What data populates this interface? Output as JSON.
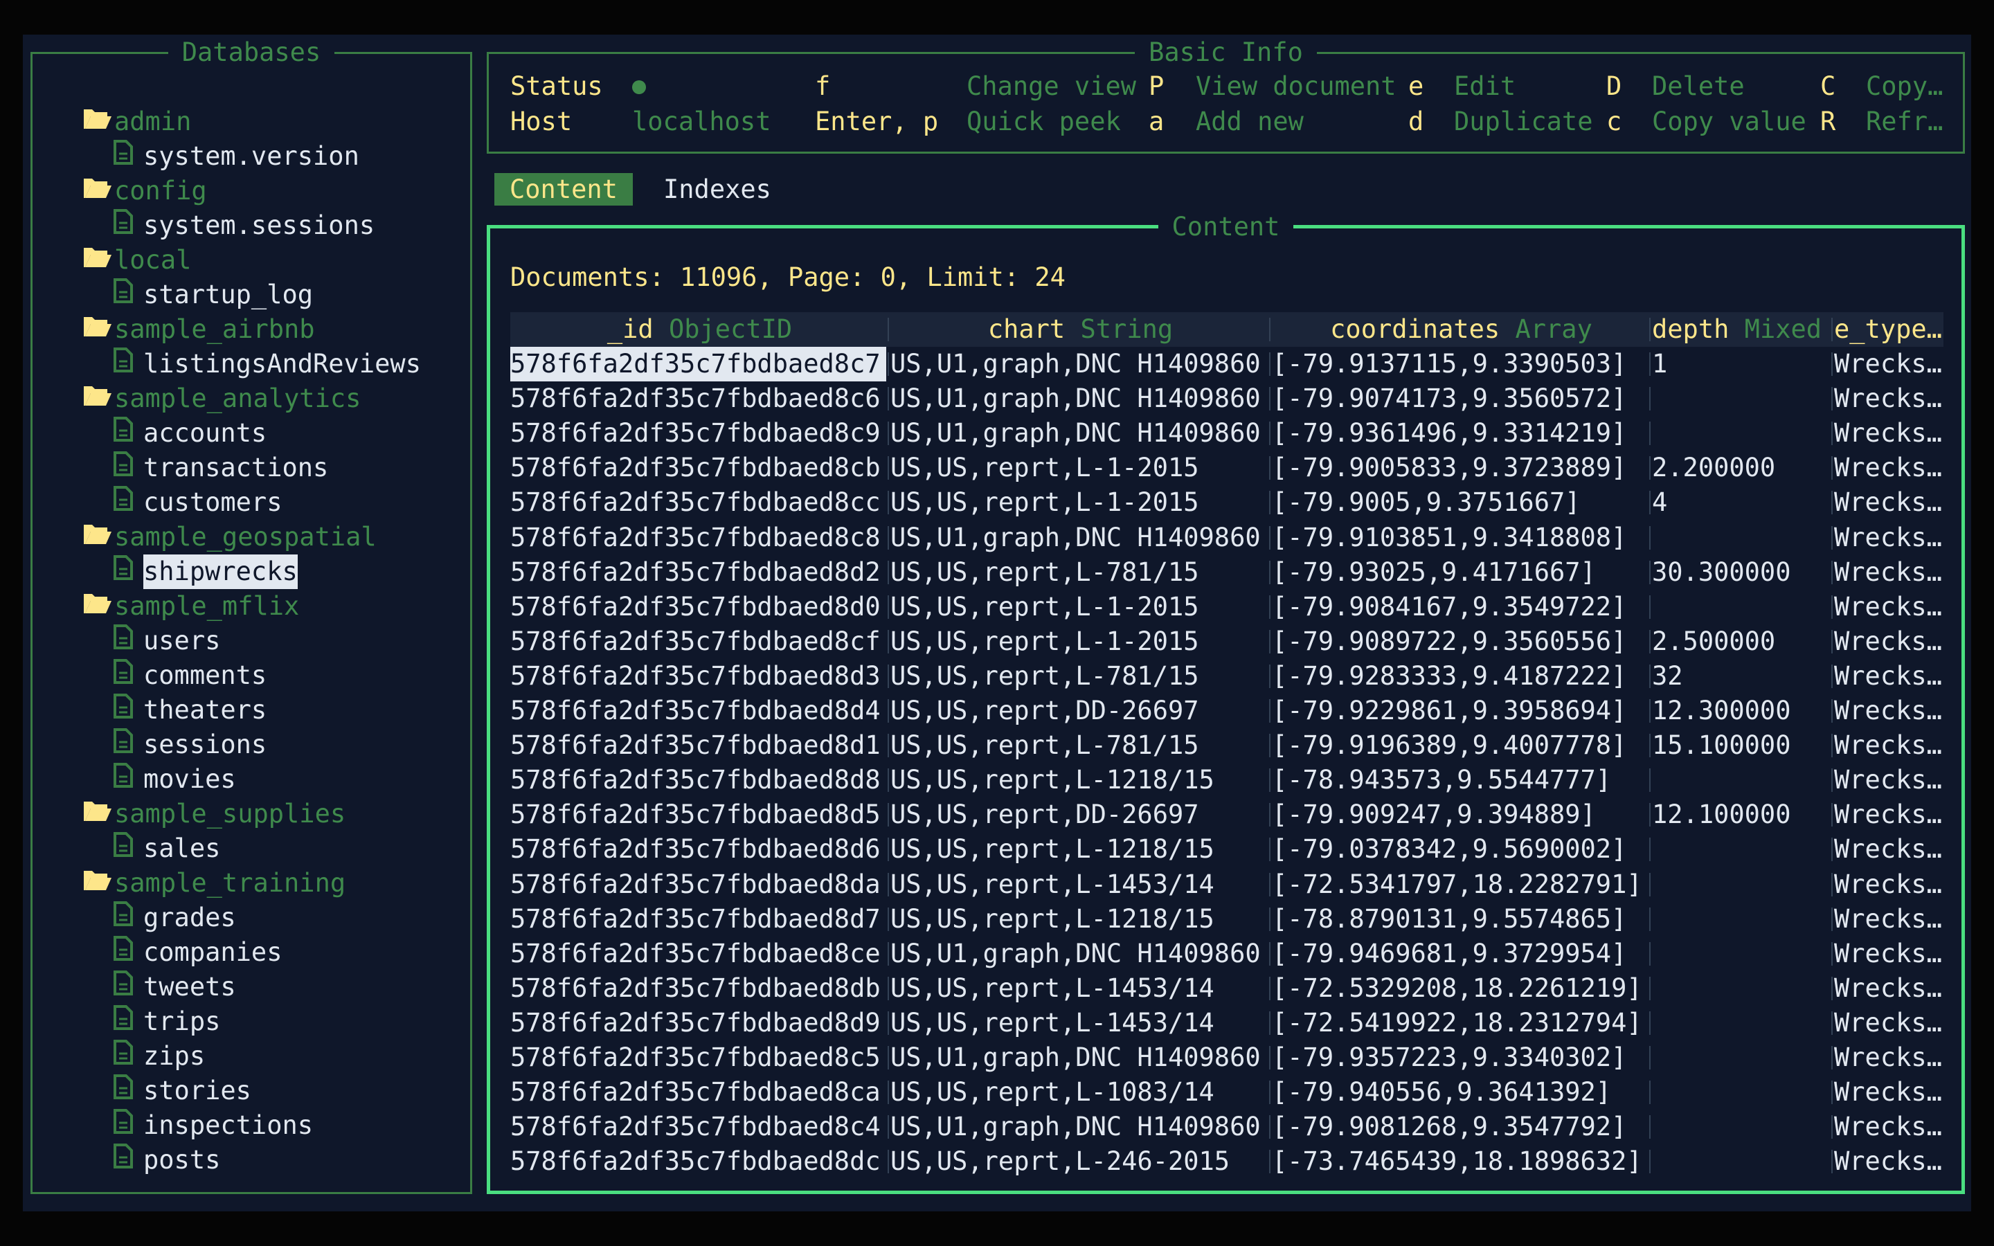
{
  "colors": {
    "background": "#0f172a",
    "border": "#3a7d44",
    "active_border": "#4ade80",
    "accent_yellow": "#fde68a",
    "muted_green": "#3f8a4c",
    "status_dot": "#3f8a4c"
  },
  "sidebar": {
    "title": "Databases",
    "databases": [
      {
        "name": "admin",
        "collections": [
          "system.version"
        ]
      },
      {
        "name": "config",
        "collections": [
          "system.sessions"
        ]
      },
      {
        "name": "local",
        "collections": [
          "startup_log"
        ]
      },
      {
        "name": "sample_airbnb",
        "collections": [
          "listingsAndReviews"
        ]
      },
      {
        "name": "sample_analytics",
        "collections": [
          "accounts",
          "transactions",
          "customers"
        ]
      },
      {
        "name": "sample_geospatial",
        "collections": [
          "shipwrecks"
        ]
      },
      {
        "name": "sample_mflix",
        "collections": [
          "users",
          "comments",
          "theaters",
          "sessions",
          "movies"
        ]
      },
      {
        "name": "sample_supplies",
        "collections": [
          "sales"
        ]
      },
      {
        "name": "sample_training",
        "collections": [
          "grades",
          "companies",
          "tweets",
          "trips",
          "zips",
          "stories",
          "inspections",
          "posts"
        ]
      }
    ],
    "selected": "shipwrecks",
    "folder_icon": "folder-open-icon",
    "file_icon": "document-icon"
  },
  "basic_info": {
    "title": "Basic Info",
    "status_label": "Status",
    "status_icon": "status-dot-icon",
    "host_label": "Host",
    "host_value": "localhost",
    "shortcuts": [
      {
        "key": "f",
        "action": "Change view"
      },
      {
        "key": "P",
        "action": "View document"
      },
      {
        "key": "e",
        "action": "Edit"
      },
      {
        "key": "D",
        "action": "Delete"
      },
      {
        "key": "C",
        "action": "Copy…"
      },
      {
        "key": "Enter, p",
        "action": "Quick peek"
      },
      {
        "key": "a",
        "action": "Add new"
      },
      {
        "key": "d",
        "action": "Duplicate"
      },
      {
        "key": "c",
        "action": "Copy value"
      },
      {
        "key": "R",
        "action": "Refr…"
      }
    ]
  },
  "tabs": [
    {
      "label": "Content",
      "active": true
    },
    {
      "label": "Indexes",
      "active": false
    }
  ],
  "content": {
    "title": "Content",
    "summary": "Documents: 11096, Page: 0, Limit: 24",
    "columns": [
      {
        "name": "_id",
        "type": "ObjectID"
      },
      {
        "name": "chart",
        "type": "String"
      },
      {
        "name": "coordinates",
        "type": "Array"
      },
      {
        "name": "depth",
        "type": "Mixed"
      },
      {
        "name": "e_type…",
        "type": ""
      }
    ],
    "rows": [
      [
        "578f6fa2df35c7fbdbaed8c7",
        "US,U1,graph,DNC H1409860",
        "[-79.9137115,9.3390503]",
        "1",
        "Wrecks…"
      ],
      [
        "578f6fa2df35c7fbdbaed8c6",
        "US,U1,graph,DNC H1409860",
        "[-79.9074173,9.3560572]",
        "",
        "Wrecks…"
      ],
      [
        "578f6fa2df35c7fbdbaed8c9",
        "US,U1,graph,DNC H1409860",
        "[-79.9361496,9.3314219]",
        "",
        "Wrecks…"
      ],
      [
        "578f6fa2df35c7fbdbaed8cb",
        "US,US,reprt,L-1-2015",
        "[-79.9005833,9.3723889]",
        "2.200000",
        "Wrecks…"
      ],
      [
        "578f6fa2df35c7fbdbaed8cc",
        "US,US,reprt,L-1-2015",
        "[-79.9005,9.3751667]",
        "4",
        "Wrecks…"
      ],
      [
        "578f6fa2df35c7fbdbaed8c8",
        "US,U1,graph,DNC H1409860",
        "[-79.9103851,9.3418808]",
        "",
        "Wrecks…"
      ],
      [
        "578f6fa2df35c7fbdbaed8d2",
        "US,US,reprt,L-781/15",
        "[-79.93025,9.4171667]",
        "30.300000",
        "Wrecks…"
      ],
      [
        "578f6fa2df35c7fbdbaed8d0",
        "US,US,reprt,L-1-2015",
        "[-79.9084167,9.3549722]",
        "",
        "Wrecks…"
      ],
      [
        "578f6fa2df35c7fbdbaed8cf",
        "US,US,reprt,L-1-2015",
        "[-79.9089722,9.3560556]",
        "2.500000",
        "Wrecks…"
      ],
      [
        "578f6fa2df35c7fbdbaed8d3",
        "US,US,reprt,L-781/15",
        "[-79.9283333,9.4187222]",
        "32",
        "Wrecks…"
      ],
      [
        "578f6fa2df35c7fbdbaed8d4",
        "US,US,reprt,DD-26697",
        "[-79.9229861,9.3958694]",
        "12.300000",
        "Wrecks…"
      ],
      [
        "578f6fa2df35c7fbdbaed8d1",
        "US,US,reprt,L-781/15",
        "[-79.9196389,9.4007778]",
        "15.100000",
        "Wrecks…"
      ],
      [
        "578f6fa2df35c7fbdbaed8d8",
        "US,US,reprt,L-1218/15",
        "[-78.943573,9.5544777]",
        "",
        "Wrecks…"
      ],
      [
        "578f6fa2df35c7fbdbaed8d5",
        "US,US,reprt,DD-26697",
        "[-79.909247,9.394889]",
        "12.100000",
        "Wrecks…"
      ],
      [
        "578f6fa2df35c7fbdbaed8d6",
        "US,US,reprt,L-1218/15",
        "[-79.0378342,9.5690002]",
        "",
        "Wrecks…"
      ],
      [
        "578f6fa2df35c7fbdbaed8da",
        "US,US,reprt,L-1453/14",
        "[-72.5341797,18.2282791]",
        "",
        "Wrecks…"
      ],
      [
        "578f6fa2df35c7fbdbaed8d7",
        "US,US,reprt,L-1218/15",
        "[-78.8790131,9.5574865]",
        "",
        "Wrecks…"
      ],
      [
        "578f6fa2df35c7fbdbaed8ce",
        "US,U1,graph,DNC H1409860",
        "[-79.9469681,9.3729954]",
        "",
        "Wrecks…"
      ],
      [
        "578f6fa2df35c7fbdbaed8db",
        "US,US,reprt,L-1453/14",
        "[-72.5329208,18.2261219]",
        "",
        "Wrecks…"
      ],
      [
        "578f6fa2df35c7fbdbaed8d9",
        "US,US,reprt,L-1453/14",
        "[-72.5419922,18.2312794]",
        "",
        "Wrecks…"
      ],
      [
        "578f6fa2df35c7fbdbaed8c5",
        "US,U1,graph,DNC H1409860",
        "[-79.9357223,9.3340302]",
        "",
        "Wrecks…"
      ],
      [
        "578f6fa2df35c7fbdbaed8ca",
        "US,US,reprt,L-1083/14",
        "[-79.940556,9.3641392]",
        "",
        "Wrecks…"
      ],
      [
        "578f6fa2df35c7fbdbaed8c4",
        "US,U1,graph,DNC H1409860",
        "[-79.9081268,9.3547792]",
        "",
        "Wrecks…"
      ],
      [
        "578f6fa2df35c7fbdbaed8dc",
        "US,US,reprt,L-246-2015",
        "[-73.7465439,18.1898632]",
        "",
        "Wrecks…"
      ]
    ]
  }
}
